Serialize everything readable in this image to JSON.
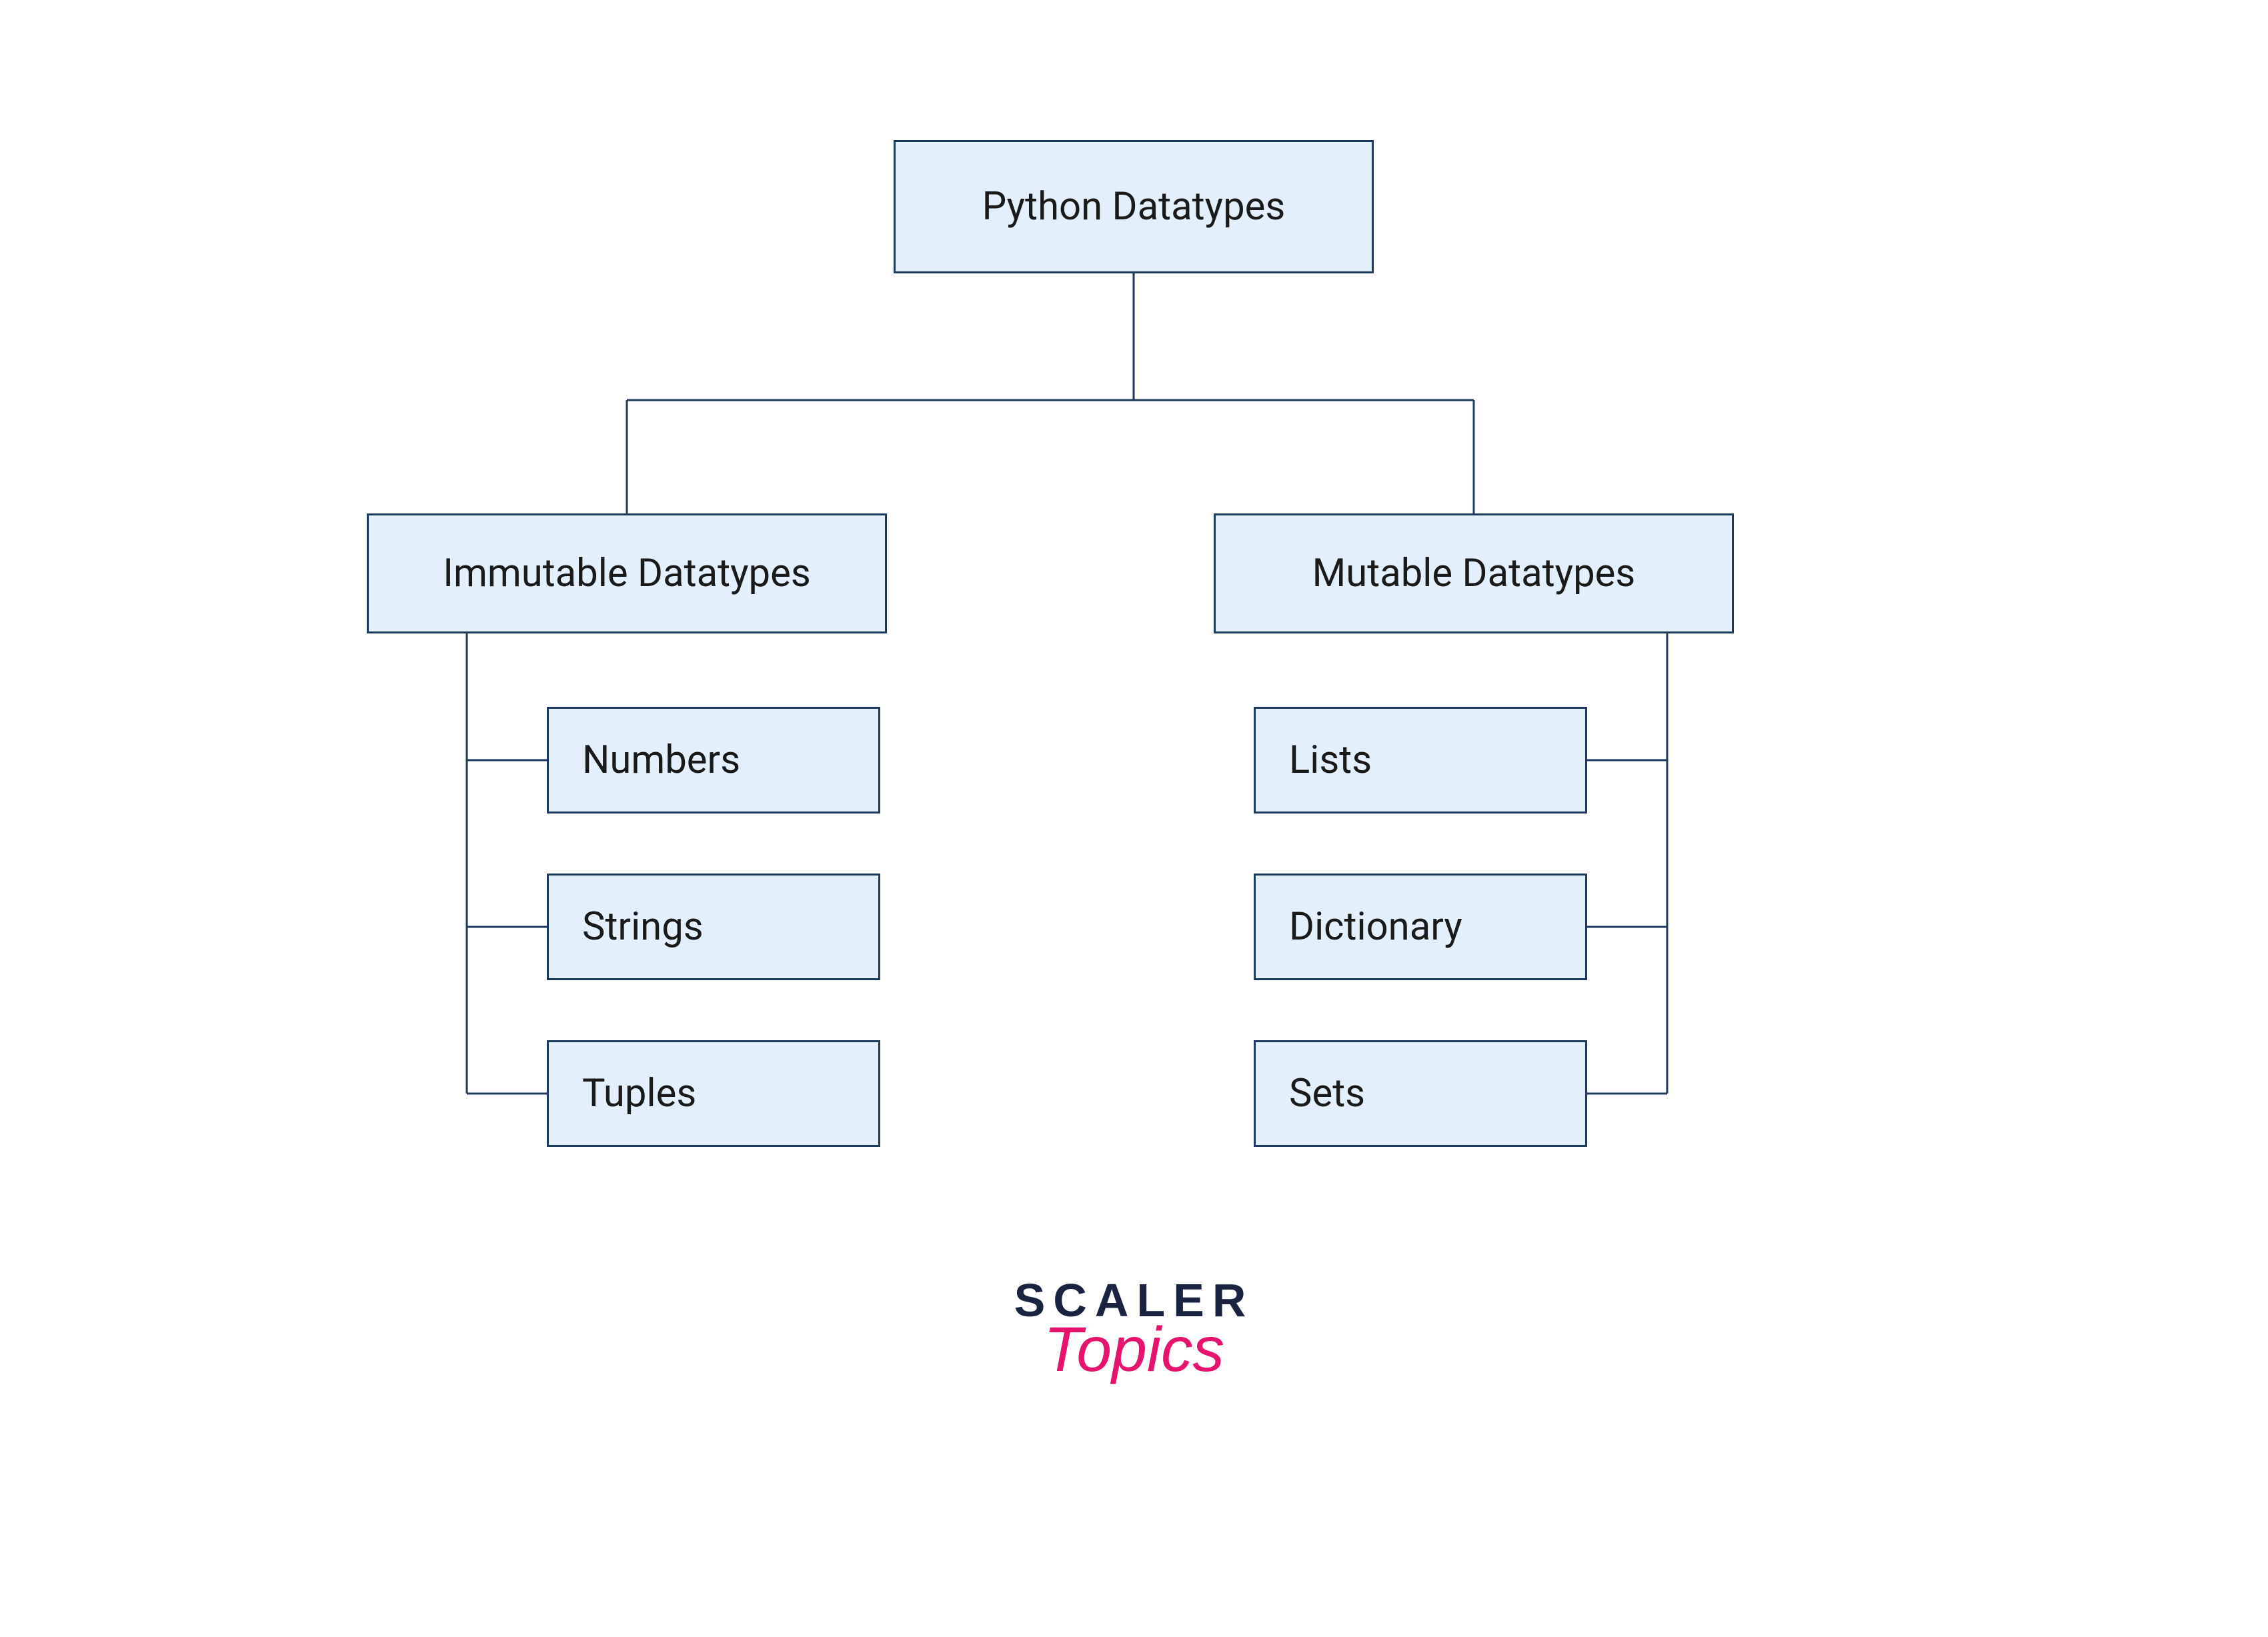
{
  "diagram": {
    "root": "Python Datatypes",
    "branches": {
      "immutable": {
        "label": "Immutable Datatypes",
        "items": [
          "Numbers",
          "Strings",
          "Tuples"
        ]
      },
      "mutable": {
        "label": "Mutable Datatypes",
        "items": [
          "Lists",
          "Dictionary",
          "Sets"
        ]
      }
    }
  },
  "logo": {
    "line1": "SCALER",
    "line2": "Topics"
  },
  "colors": {
    "box_fill": "#e3f0fb",
    "box_border": "#1e3a5f",
    "logo_dark": "#1a2340",
    "logo_accent": "#e6136f"
  }
}
